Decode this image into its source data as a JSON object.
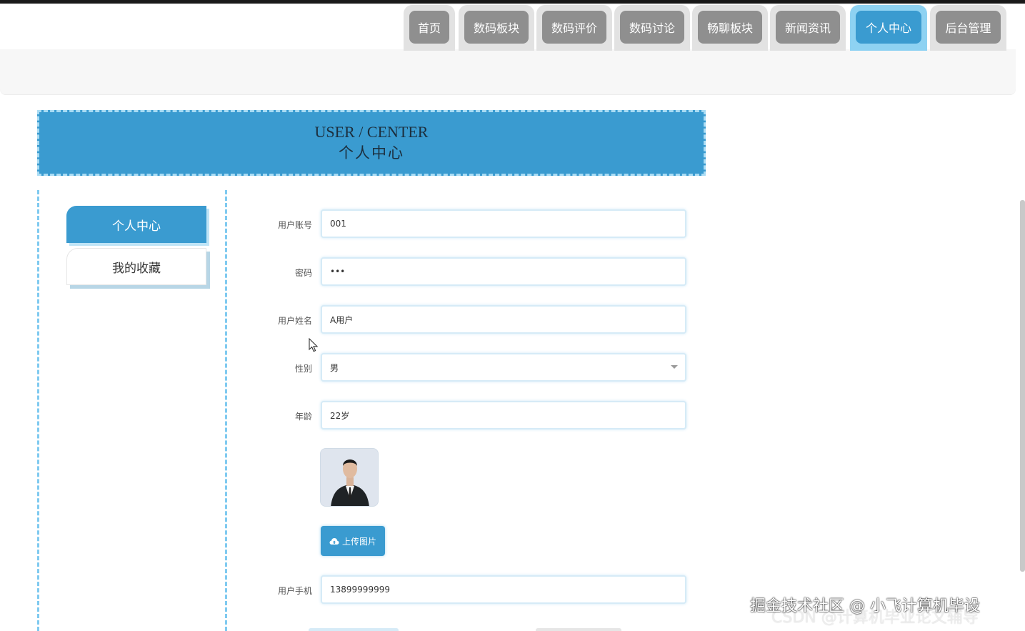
{
  "nav": {
    "tabs": [
      {
        "label": "首页",
        "active": false
      },
      {
        "label": "数码板块",
        "active": false
      },
      {
        "label": "数码评价",
        "active": false
      },
      {
        "label": "数码讨论",
        "active": false
      },
      {
        "label": "畅聊板块",
        "active": false
      },
      {
        "label": "新闻资讯",
        "active": false
      },
      {
        "label": "个人中心",
        "active": true
      },
      {
        "label": "后台管理",
        "active": false
      }
    ]
  },
  "banner": {
    "title": "USER / CENTER",
    "subtitle": "个人中心"
  },
  "sidebar": {
    "items": [
      {
        "label": "个人中心",
        "active": true
      },
      {
        "label": "我的收藏",
        "active": false
      }
    ]
  },
  "form": {
    "account_label": "用户账号",
    "account_value": "001",
    "password_label": "密码",
    "password_value": "•••",
    "name_label": "用户姓名",
    "name_value": "A用户",
    "gender_label": "性别",
    "gender_value": "男",
    "age_label": "年龄",
    "age_value": "22岁",
    "upload_label": "上传图片",
    "phone_label": "用户手机",
    "phone_value": "13899999999"
  },
  "watermark": {
    "line1": "掘金技术社区 @ 小飞计算机毕设",
    "line2": "CSDN @计算机毕业论文辅导"
  },
  "colors": {
    "accent": "#3a9bd0",
    "accent_light": "#8ed2f2",
    "tab_gray": "#8f8f8f",
    "dash_blue": "#7fcaf0"
  }
}
